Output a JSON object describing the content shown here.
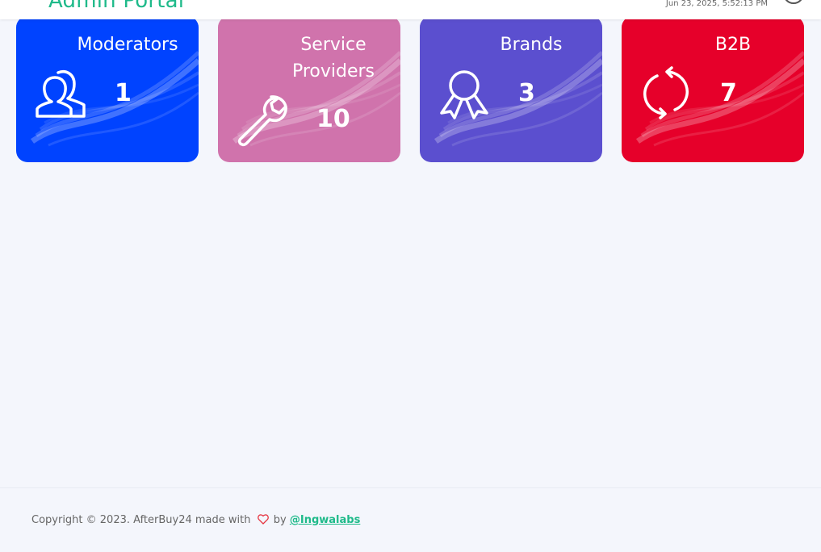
{
  "header": {
    "brand": "Admin Portal",
    "datetime": "Jun 23, 2025, 5:52:13 PM",
    "menu_icon": "hamburger-menu-icon",
    "avatar_icon": "user-avatar-icon",
    "brand_color": "#1fba8a"
  },
  "cards": [
    {
      "title": "Moderators",
      "count": "1",
      "icon": "users-icon",
      "color": "#0043ff"
    },
    {
      "title": "Service Providers",
      "count": "10",
      "icon": "wrench-icon",
      "color": "#d073ac"
    },
    {
      "title": "Brands",
      "count": "3",
      "icon": "award-icon",
      "color": "#5b4fcf"
    },
    {
      "title": "B2B",
      "count": "7",
      "icon": "refresh-icon",
      "color": "#e6002a"
    }
  ],
  "footer": {
    "copyright": "Copyright © 2023. AfterBuy24 made with",
    "by": "by",
    "link": "@Ingwalabs",
    "heart_icon": "heart-icon",
    "heart_color": "#e6333f"
  }
}
